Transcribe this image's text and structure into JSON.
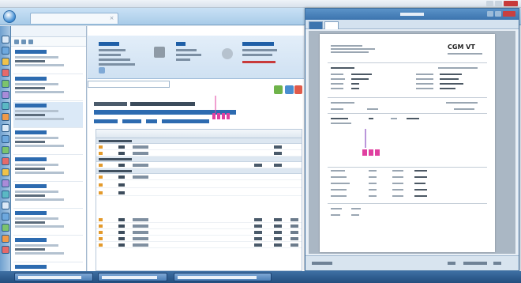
{
  "window": {
    "title": ""
  },
  "outer_tab": {
    "label": "",
    "close_glyph": "×"
  },
  "patient_list": {
    "header": "",
    "items": [
      {
        "name": "",
        "selected": false
      },
      {
        "name": "",
        "selected": false
      },
      {
        "name": "",
        "selected": true
      },
      {
        "name": "",
        "selected": false
      },
      {
        "name": "",
        "selected": false
      },
      {
        "name": "",
        "selected": false
      },
      {
        "name": "",
        "selected": false
      },
      {
        "name": "",
        "selected": false
      },
      {
        "name": "",
        "selected": false
      }
    ]
  },
  "main": {
    "section_title": "",
    "subheading": "",
    "grid": {
      "groups": [
        "",
        "",
        ""
      ]
    }
  },
  "document": {
    "title": "",
    "logo_text": "CGM VT"
  },
  "taskbar": {
    "items": [
      "",
      "",
      ""
    ]
  },
  "colors": {
    "accent": "#2d6bb0",
    "title_bar": "#3c74ae",
    "chart_bar": "#e040a0",
    "close": "#c83a3a"
  }
}
